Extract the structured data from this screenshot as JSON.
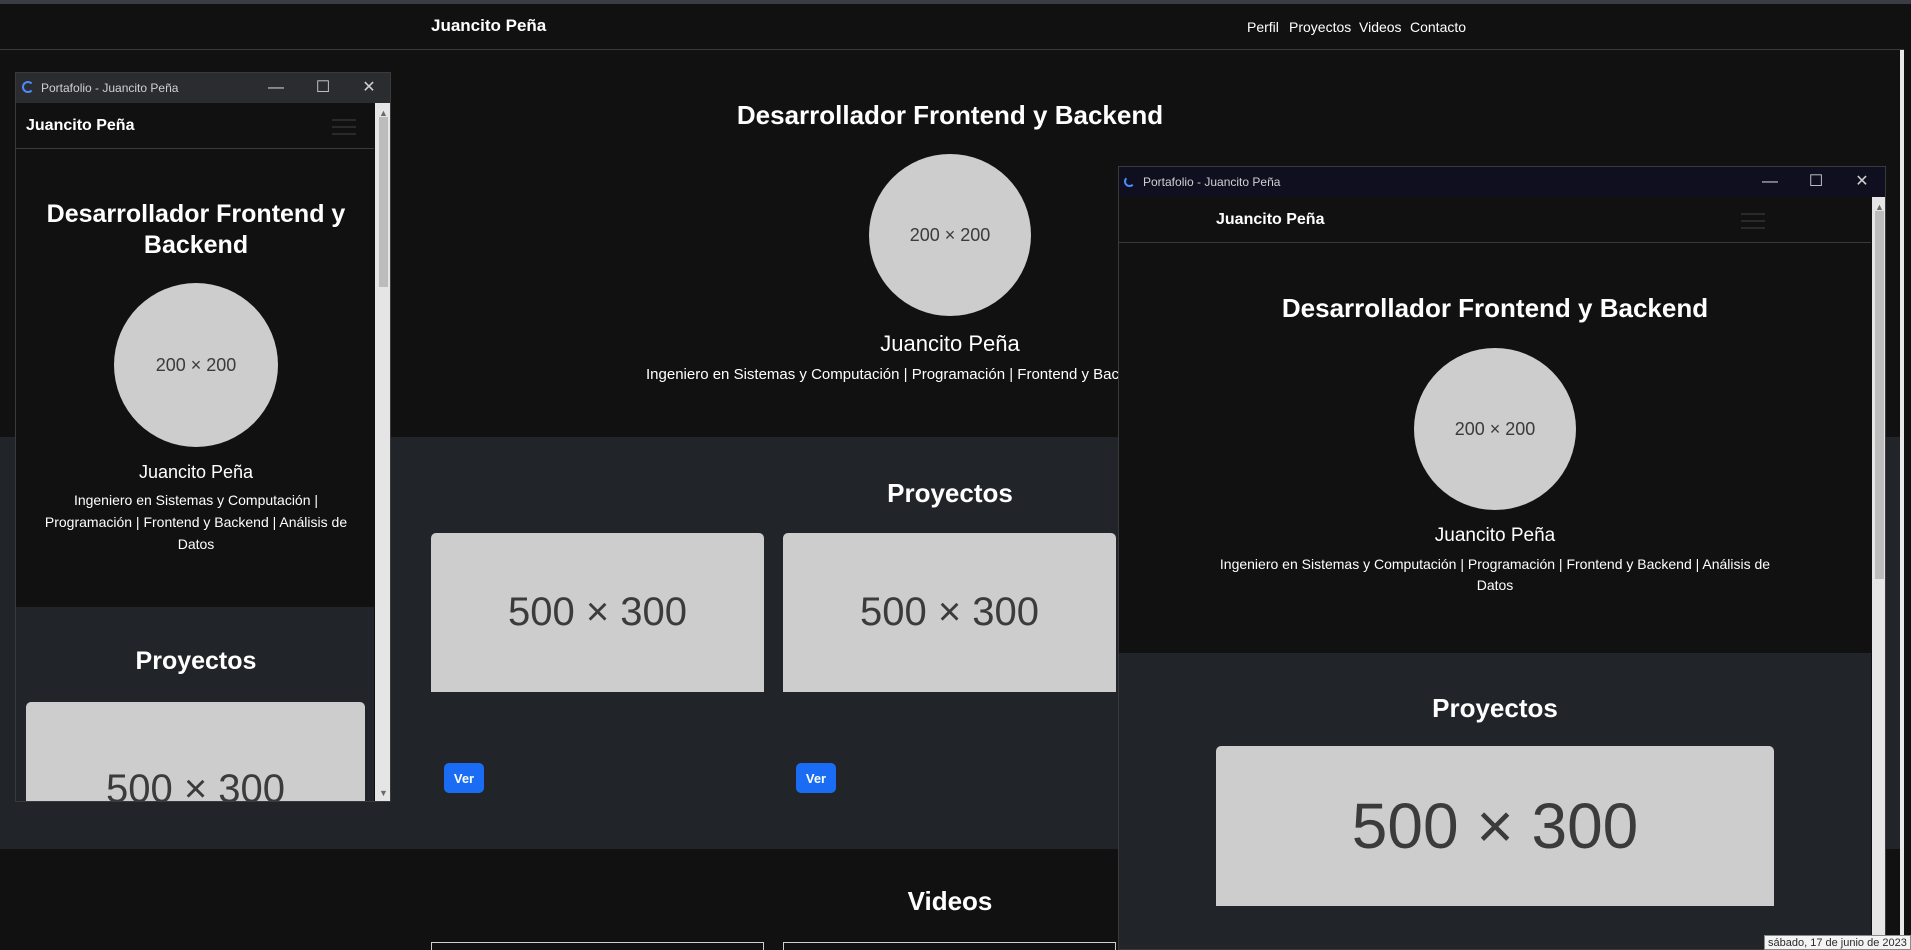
{
  "main": {
    "brand": "Juancito Peña",
    "nav": [
      "Perfil",
      "Proyectos",
      "Videos",
      "Contacto"
    ],
    "hero_title": "Desarrollador Frontend y Backend",
    "avatar_placeholder": "200 × 200",
    "name": "Juancito Peña",
    "subtitle": "Ingeniero en Sistemas y Computación | Programación | Frontend y Backend",
    "projects_title": "Proyectos",
    "project_cards": [
      {
        "image_placeholder": "500 × 300",
        "button": "Ver"
      },
      {
        "image_placeholder": "500 × 300",
        "button": "Ver"
      }
    ],
    "videos_title": "Videos"
  },
  "window_small": {
    "title": "Portafolio - Juancito Peña",
    "brand": "Juancito Peña",
    "hero_title": "Desarrollador Frontend y Backend",
    "avatar_placeholder": "200 × 200",
    "name": "Juancito Peña",
    "subtitle": "Ingeniero en Sistemas y Computación | Programación | Frontend y Backend | Análisis de Datos",
    "projects_title": "Proyectos",
    "card_placeholder": "500 × 300"
  },
  "window_medium": {
    "title": "Portafolio - Juancito Peña",
    "brand": "Juancito Peña",
    "hero_title": "Desarrollador Frontend y Backend",
    "avatar_placeholder": "200 × 200",
    "name": "Juancito Peña",
    "subtitle": "Ingeniero en Sistemas y Computación | Programación | Frontend y Backend | Análisis de Datos",
    "projects_title": "Proyectos",
    "card_placeholder": "500 × 300"
  },
  "tooltip": "sábado, 17 de junio de 2023",
  "icons": {
    "minimize": "minimize-icon",
    "maximize": "maximize-icon",
    "close": "close-icon",
    "menu": "hamburger-menu-icon",
    "loading": "loading-icon"
  },
  "colors": {
    "page_bg": "#111112",
    "section_bg": "#212529",
    "placeholder": "#cdcdcd",
    "button": "#1a6cf5",
    "titlebar": "#2b2c30"
  }
}
